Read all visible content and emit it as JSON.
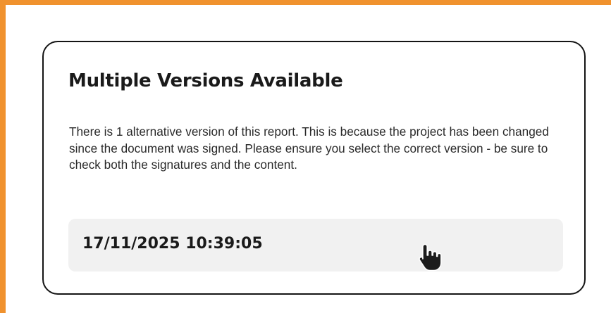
{
  "dialog": {
    "title": "Multiple Versions Available",
    "message": "There is 1 alternative version of this report. This is because the project has been changed since the document was signed. Please ensure you select the correct version - be sure to check both the signatures and the content.",
    "versions": [
      {
        "label": "17/11/2025 10:39:05"
      }
    ]
  },
  "cursor": {
    "type": "hand-pointer-icon"
  },
  "colors": {
    "frame_border": "#f0922e",
    "modal_border": "#141414",
    "version_background": "#f1f1f1",
    "text": "#1a1a1a"
  }
}
